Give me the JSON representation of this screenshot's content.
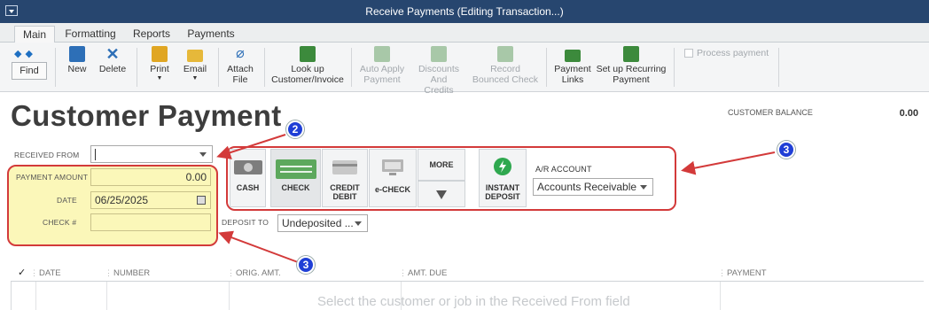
{
  "window": {
    "title": "Receive Payments (Editing Transaction...)"
  },
  "tabs": [
    "Main",
    "Formatting",
    "Reports",
    "Payments"
  ],
  "toolbar": {
    "find": "Find",
    "new": "New",
    "delete": "Delete",
    "print": "Print",
    "email": "Email",
    "attach_1": "Attach",
    "attach_2": "File",
    "lookup_1": "Look up",
    "lookup_2": "Customer/Invoice",
    "autoapply_1": "Auto Apply",
    "autoapply_2": "Payment",
    "discounts_1": "Discounts And",
    "discounts_2": "Credits",
    "record_1": "Record",
    "record_2": "Bounced Check",
    "paylinks_1": "Payment",
    "paylinks_2": "Links",
    "recurring_1": "Set up Recurring",
    "recurring_2": "Payment",
    "process_payment": "Process payment"
  },
  "form": {
    "heading": "Customer Payment",
    "customer_balance_label": "CUSTOMER BALANCE",
    "customer_balance_value": "0.00",
    "received_from_label": "RECEIVED FROM",
    "received_from_value": "",
    "payment_amount_label": "PAYMENT AMOUNT",
    "payment_amount_value": "0.00",
    "date_label": "DATE",
    "date_value": "06/25/2025",
    "check_label": "CHECK #",
    "check_value": "",
    "deposit_to_label": "DEPOSIT TO",
    "deposit_to_value": "Undeposited ...",
    "ar_account_label": "A/R ACCOUNT",
    "ar_account_value": "Accounts Receivable"
  },
  "payment_methods": {
    "cash": "CASH",
    "check": "CHECK",
    "credit_1": "CREDIT",
    "credit_2": "DEBIT",
    "echeck": "e-CHECK",
    "more": "MORE",
    "instant_1": "INSTANT",
    "instant_2": "DEPOSIT"
  },
  "markers": {
    "m2": "2",
    "m3a": "3",
    "m3b": "3"
  },
  "table": {
    "check_col": "✓",
    "columns": [
      "DATE",
      "NUMBER",
      "ORIG. AMT.",
      "AMT. DUE",
      "PAYMENT"
    ],
    "empty_message": "Select the customer or job in the Received From field"
  },
  "colors": {
    "title_bar": "#27466f",
    "annotation_red": "#d33a3a",
    "highlight_yellow": "#fbf7b9",
    "marker_blue": "#1f3fd6",
    "instant_green": "#2fa84f"
  }
}
